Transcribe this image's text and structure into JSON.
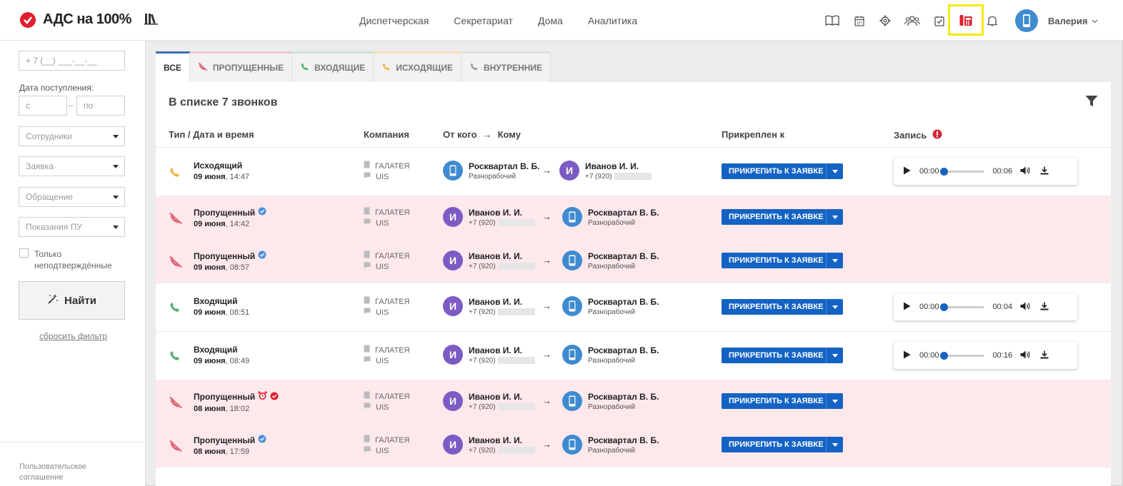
{
  "app": {
    "title": "АДС на 100%"
  },
  "nav": {
    "items": [
      "Диспетчерская",
      "Секретариат",
      "Дома",
      "Аналитика"
    ]
  },
  "user": {
    "name": "Валерия"
  },
  "sidebar": {
    "phone_placeholder": "+ 7 (__) ___-__-__",
    "date_label": "Дата поступления:",
    "date_from": "с",
    "date_to": "по",
    "date_dash": "–",
    "employees": "Сотрудники",
    "request": "Заявка",
    "appeal": "Обращение",
    "meter": "Показания ПУ",
    "only_unconfirmed_1": "Только",
    "only_unconfirmed_2": "неподтверждённые",
    "find": "Найти",
    "reset": "сбросить фильтр",
    "agreement_1": "Пользовательское",
    "agreement_2": "соглашение"
  },
  "tabs": [
    "Все",
    "Пропущенные",
    "Входящие",
    "Исходящие",
    "Внутренние"
  ],
  "list": {
    "title": "В списке 7 звонков",
    "headers": {
      "type": "Тип / Дата и время",
      "company": "Компания",
      "from": "От кого",
      "arrow": "→",
      "to": "Кому",
      "attached": "Прикреплен к",
      "record": "Запись"
    }
  },
  "attach_label": "ПРИКРЕПИТЬ К ЗАЯВКЕ",
  "rows": [
    {
      "type": "Исходящий",
      "date": "09 июня",
      "time": ", 14:47",
      "company": "ГАЛАТЕЯ",
      "provider": "UIS",
      "from_name": "Росквартал В. Б.",
      "from_sub": "Разнорабочий",
      "to_name": "Иванов И. И.",
      "to_sub": "+7 (920)",
      "to_initial": "И",
      "record": {
        "start": "00:00",
        "end": "00:06"
      }
    },
    {
      "type": "Пропущенный",
      "date": "09 июня",
      "time": ", 14:42",
      "company": "ГАЛАТЕЯ",
      "provider": "UIS",
      "from_name": "Иванов И. И.",
      "from_sub": "+7 (920)",
      "from_initial": "И",
      "to_name": "Росквартал В. Б.",
      "to_sub": "Разнорабочий"
    },
    {
      "type": "Пропущенный",
      "date": "09 июня",
      "time": ", 08:57",
      "company": "ГАЛАТЕЯ",
      "provider": "UIS",
      "from_name": "Иванов И. И.",
      "from_sub": "+7 (920)",
      "from_initial": "И",
      "to_name": "Росквартал В. Б.",
      "to_sub": "Разнорабочий"
    },
    {
      "type": "Входящий",
      "date": "09 июня",
      "time": ", 08:51",
      "company": "ГАЛАТЕЯ",
      "provider": "UIS",
      "from_name": "Иванов И. И.",
      "from_sub": "+7 (920)",
      "from_initial": "И",
      "to_name": "Росквартал В. Б.",
      "to_sub": "Разнорабочий",
      "record": {
        "start": "00:00",
        "end": "00:04"
      }
    },
    {
      "type": "Входящий",
      "date": "09 июня",
      "time": ", 08:49",
      "company": "ГАЛАТЕЯ",
      "provider": "UIS",
      "from_name": "Иванов И. И.",
      "from_sub": "+7 (920)",
      "from_initial": "И",
      "to_name": "Росквартал В. Б.",
      "to_sub": "Разнорабочий",
      "record": {
        "start": "00:00",
        "end": "00:16"
      }
    },
    {
      "type": "Пропущенный",
      "date": "08 июня",
      "time": ", 18:02",
      "company": "ГАЛАТЕЯ",
      "provider": "UIS",
      "from_name": "Иванов И. И.",
      "from_sub": "+7 (920)",
      "from_initial": "И",
      "to_name": "Росквартал В. Б.",
      "to_sub": "Разнорабочий"
    },
    {
      "type": "Пропущенный",
      "date": "08 июня",
      "time": ", 17:59",
      "company": "ГАЛАТЕЯ",
      "provider": "UIS",
      "from_name": "Иванов И. И.",
      "from_sub": "+7 (920)",
      "from_initial": "И",
      "to_name": "Росквартал В. Б.",
      "to_sub": "Разнорабочий"
    }
  ],
  "colors": {
    "accent": "#1463c4",
    "missed_row": "#fde8ec",
    "brand_red": "#e0202e",
    "highlight": "#f4ea16"
  }
}
